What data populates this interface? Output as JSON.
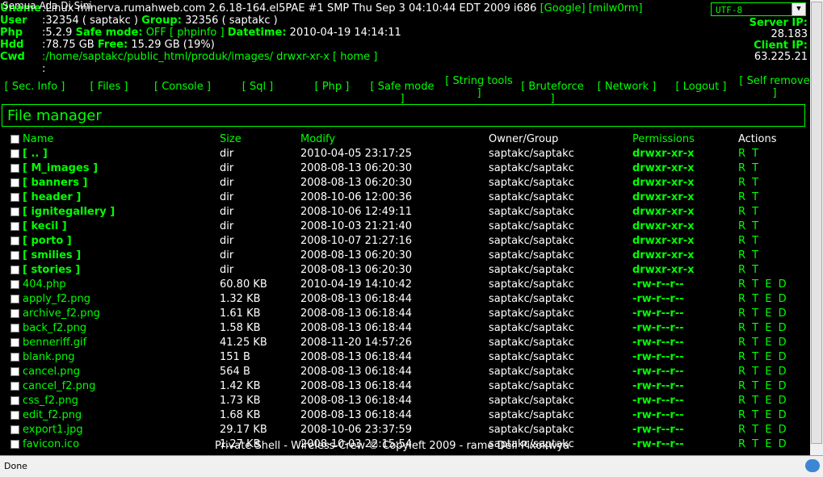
{
  "window_title": "Semua Ada Di Sini",
  "info": {
    "uname_label": "Uname",
    "uname_value": ":Linux minerva.rumahweb.com 2.6.18-164.el5PAE #1 SMP Thu Sep 3 04:10:44 EDT 2009 i686",
    "google": "[Google]",
    "milw0rm": "[milw0rm]",
    "user_label": "User",
    "user_value": ":32354 ( saptakc )",
    "group_label": "Group:",
    "group_value": "32356 ( saptakc )",
    "php_label": "Php",
    "php_value": ":5.2.9",
    "safemode_label": "Safe mode:",
    "safemode_value": "OFF",
    "phpinfo": "[ phpinfo ]",
    "datetime_label": "Datetime:",
    "datetime_value": "2010-04-19 14:14:11",
    "hdd_label": "Hdd",
    "hdd_value": ":78.75 GB",
    "free_label": "Free:",
    "free_value": "15.29 GB (19%)",
    "cwd_label": "Cwd",
    "cwd_value": ":/home/saptakc/public_html/produk/images/",
    "cwd_perm": "drwxr-xr-x",
    "home": "[ home ]",
    "colon": ":"
  },
  "charset": "UTF-8",
  "server_ip_label": "Server IP:",
  "server_ip": "28.183",
  "client_ip_label": "Client IP:",
  "client_ip": "63.225.21",
  "menu": [
    "[ Sec. Info ]",
    "[ Files ]",
    "[ Console ]",
    "[ Sql ]",
    "[ Php ]",
    "[ Safe mode ]",
    "[ String tools ]",
    "[ Bruteforce ]",
    "[ Network ]",
    "[ Logout ]",
    "[ Self remove ]"
  ],
  "section_title": "File manager",
  "columns": {
    "name": "Name",
    "size": "Size",
    "modify": "Modify",
    "owner": "Owner/Group",
    "perms": "Permissions",
    "actions": "Actions"
  },
  "rows": [
    {
      "name": "[ .. ]",
      "size": "dir",
      "modify": "2010-04-05 23:17:25",
      "owner": "saptakc/saptakc",
      "perms": "drwxr-xr-x",
      "actions": "R T",
      "dir": true
    },
    {
      "name": "[ M_images ]",
      "size": "dir",
      "modify": "2008-08-13 06:20:30",
      "owner": "saptakc/saptakc",
      "perms": "drwxr-xr-x",
      "actions": "R T",
      "dir": true
    },
    {
      "name": "[ banners ]",
      "size": "dir",
      "modify": "2008-08-13 06:20:30",
      "owner": "saptakc/saptakc",
      "perms": "drwxr-xr-x",
      "actions": "R T",
      "dir": true
    },
    {
      "name": "[ header ]",
      "size": "dir",
      "modify": "2008-10-06 12:00:36",
      "owner": "saptakc/saptakc",
      "perms": "drwxr-xr-x",
      "actions": "R T",
      "dir": true
    },
    {
      "name": "[ ignitegallery ]",
      "size": "dir",
      "modify": "2008-10-06 12:49:11",
      "owner": "saptakc/saptakc",
      "perms": "drwxr-xr-x",
      "actions": "R T",
      "dir": true
    },
    {
      "name": "[ kecil ]",
      "size": "dir",
      "modify": "2008-10-03 21:21:40",
      "owner": "saptakc/saptakc",
      "perms": "drwxr-xr-x",
      "actions": "R T",
      "dir": true
    },
    {
      "name": "[ porto ]",
      "size": "dir",
      "modify": "2008-10-07 21:27:16",
      "owner": "saptakc/saptakc",
      "perms": "drwxr-xr-x",
      "actions": "R T",
      "dir": true
    },
    {
      "name": "[ smilies ]",
      "size": "dir",
      "modify": "2008-08-13 06:20:30",
      "owner": "saptakc/saptakc",
      "perms": "drwxr-xr-x",
      "actions": "R T",
      "dir": true
    },
    {
      "name": "[ stories ]",
      "size": "dir",
      "modify": "2008-08-13 06:20:30",
      "owner": "saptakc/saptakc",
      "perms": "drwxr-xr-x",
      "actions": "R T",
      "dir": true
    },
    {
      "name": "404.php",
      "size": "60.80 KB",
      "modify": "2010-04-19 14:10:42",
      "owner": "saptakc/saptakc",
      "perms": "-rw-r--r--",
      "actions": "R T E D",
      "dir": false
    },
    {
      "name": "apply_f2.png",
      "size": "1.32 KB",
      "modify": "2008-08-13 06:18:44",
      "owner": "saptakc/saptakc",
      "perms": "-rw-r--r--",
      "actions": "R T E D",
      "dir": false
    },
    {
      "name": "archive_f2.png",
      "size": "1.61 KB",
      "modify": "2008-08-13 06:18:44",
      "owner": "saptakc/saptakc",
      "perms": "-rw-r--r--",
      "actions": "R T E D",
      "dir": false
    },
    {
      "name": "back_f2.png",
      "size": "1.58 KB",
      "modify": "2008-08-13 06:18:44",
      "owner": "saptakc/saptakc",
      "perms": "-rw-r--r--",
      "actions": "R T E D",
      "dir": false
    },
    {
      "name": "benneriff.gif",
      "size": "41.25 KB",
      "modify": "2008-11-20 14:57:26",
      "owner": "saptakc/saptakc",
      "perms": "-rw-r--r--",
      "actions": "R T E D",
      "dir": false
    },
    {
      "name": "blank.png",
      "size": "151 B",
      "modify": "2008-08-13 06:18:44",
      "owner": "saptakc/saptakc",
      "perms": "-rw-r--r--",
      "actions": "R T E D",
      "dir": false
    },
    {
      "name": "cancel.png",
      "size": "564 B",
      "modify": "2008-08-13 06:18:44",
      "owner": "saptakc/saptakc",
      "perms": "-rw-r--r--",
      "actions": "R T E D",
      "dir": false
    },
    {
      "name": "cancel_f2.png",
      "size": "1.42 KB",
      "modify": "2008-08-13 06:18:44",
      "owner": "saptakc/saptakc",
      "perms": "-rw-r--r--",
      "actions": "R T E D",
      "dir": false
    },
    {
      "name": "css_f2.png",
      "size": "1.73 KB",
      "modify": "2008-08-13 06:18:44",
      "owner": "saptakc/saptakc",
      "perms": "-rw-r--r--",
      "actions": "R T E D",
      "dir": false
    },
    {
      "name": "edit_f2.png",
      "size": "1.68 KB",
      "modify": "2008-08-13 06:18:44",
      "owner": "saptakc/saptakc",
      "perms": "-rw-r--r--",
      "actions": "R T E D",
      "dir": false
    },
    {
      "name": "export1.jpg",
      "size": "29.17 KB",
      "modify": "2008-10-06 23:37:59",
      "owner": "saptakc/saptakc",
      "perms": "-rw-r--r--",
      "actions": "R T E D",
      "dir": false
    },
    {
      "name": "favicon.ico",
      "size": "1.27 KB",
      "modify": "2008-10-03 22:15:54",
      "owner": "saptakc/saptakc",
      "perms": "-rw-r--r--",
      "actions": "R T E D",
      "dir": false
    }
  ],
  "footer": "Private Shell - Wireless-Crew © Copyleft 2009 - rame Dell Pixokwya",
  "status_text": "Done"
}
